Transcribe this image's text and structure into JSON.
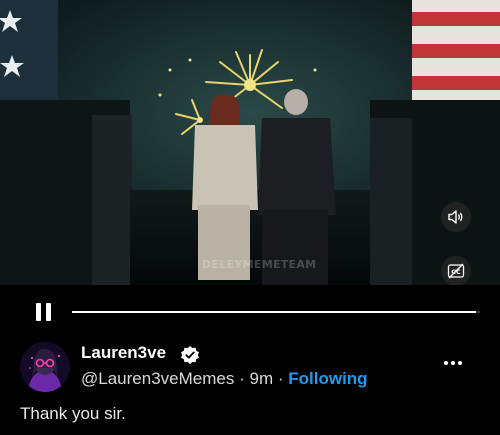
{
  "video": {
    "watermark": "DELEYMEMETEAM",
    "progress": 0.99,
    "controls": {
      "pause": "pause-icon",
      "volume": "speaker-icon",
      "captions": "captions-off-icon"
    }
  },
  "tweet": {
    "display_name": "Lauren3ve",
    "verified": true,
    "handle": "@Lauren3veMemes",
    "separator": "·",
    "time": "9m",
    "follow_label": "Following",
    "text": "Thank you sir."
  },
  "colors": {
    "accent": "#1d9bf0",
    "background": "#000000",
    "text": "#e7e9ea"
  }
}
